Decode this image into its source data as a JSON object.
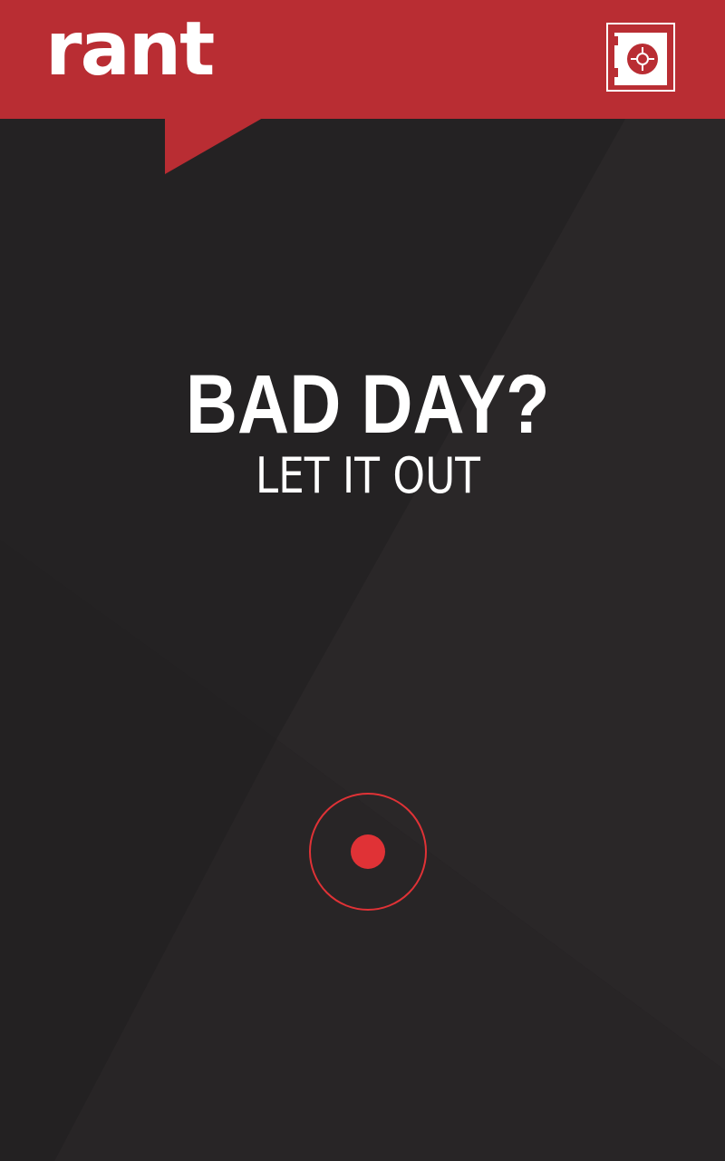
{
  "app": {
    "logo_text": "rant"
  },
  "header": {
    "vault_icon": "safe-icon"
  },
  "hero": {
    "headline": "BAD DAY?",
    "subline": "LET IT OUT"
  },
  "record": {
    "icon": "record-icon"
  },
  "colors": {
    "brand_red": "#b92d33",
    "record_red": "#e03236",
    "background": "#242223",
    "text": "#ffffff"
  }
}
